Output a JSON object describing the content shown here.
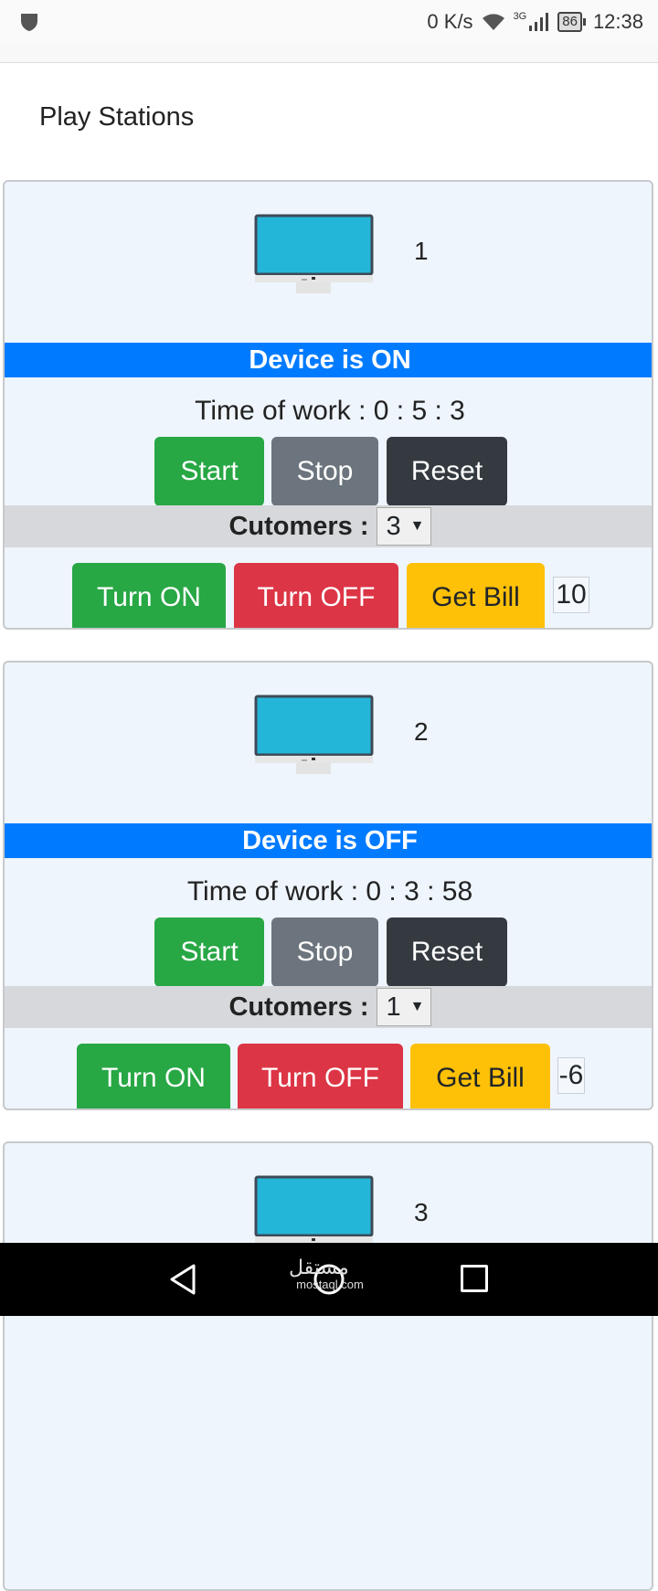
{
  "status_bar": {
    "net_speed": "0 K/s",
    "signal": "3G",
    "battery": "86",
    "time": "12:38"
  },
  "page": {
    "title": "Play Stations"
  },
  "stations": [
    {
      "number": "1",
      "status": "Device is ON",
      "time_label": "Time of work : 0 : 5 : 3",
      "start": "Start",
      "stop": "Stop",
      "reset": "Reset",
      "customers_label": "Cutomers :",
      "customers_value": "3",
      "turn_on": "Turn ON",
      "turn_off": "Turn OFF",
      "get_bill": "Get Bill",
      "bill_value": "10"
    },
    {
      "number": "2",
      "status": "Device is OFF",
      "time_label": "Time of work : 0 : 3 : 58",
      "start": "Start",
      "stop": "Stop",
      "reset": "Reset",
      "customers_label": "Cutomers :",
      "customers_value": "1",
      "turn_on": "Turn ON",
      "turn_off": "Turn OFF",
      "get_bill": "Get Bill",
      "bill_value": "-6"
    },
    {
      "number": "3"
    }
  ],
  "nav": {
    "watermark": "مستقل",
    "watermark_sub": "mostaql.com"
  },
  "colors": {
    "status_blue": "#007bff",
    "success": "#28a745",
    "secondary": "#6c757d",
    "dark": "#343a40",
    "danger": "#dc3545",
    "warning": "#ffc107",
    "card_bg": "#eef5fc",
    "monitor_screen": "#24b6d8"
  }
}
